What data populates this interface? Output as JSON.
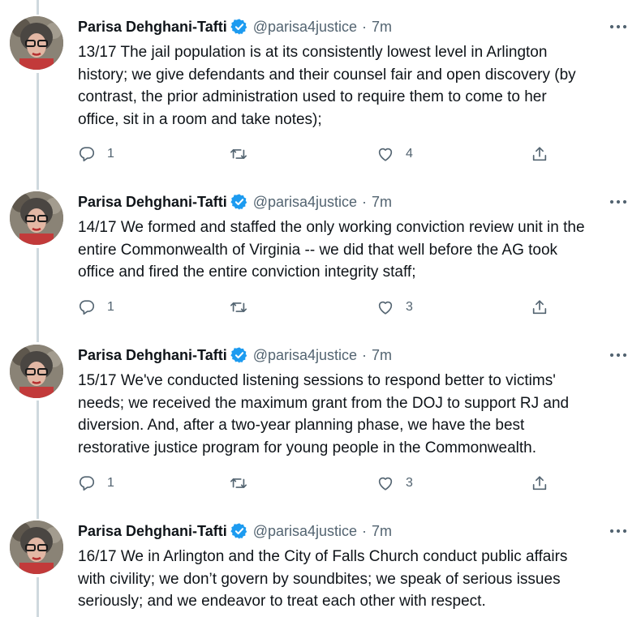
{
  "colors": {
    "text": "#0f1419",
    "secondary": "#536471",
    "verified": "#1d9bf0",
    "thread_line": "#cfd9de"
  },
  "tweets": [
    {
      "author": "Parisa Dehghani-Tafti",
      "handle": "@parisa4justice",
      "separator": "·",
      "time": "7m",
      "lines": [
        "13/17 The jail population is at its consistently lowest level in Arlington",
        "history; we give defendants and their counsel fair and open discovery (by",
        "contrast, the prior administration used to require them to come to her",
        "office, sit in a room and take notes);"
      ],
      "replies": "1",
      "retweets": "",
      "likes": "4"
    },
    {
      "author": "Parisa Dehghani-Tafti",
      "handle": "@parisa4justice",
      "separator": "·",
      "time": "7m",
      "lines": [
        "14/17 We formed and staffed the only working conviction review unit in the",
        "entire Commonwealth of Virginia -- we did that well before the AG took",
        "office and fired the entire conviction integrity staff;"
      ],
      "replies": "1",
      "retweets": "",
      "likes": "3"
    },
    {
      "author": "Parisa Dehghani-Tafti",
      "handle": "@parisa4justice",
      "separator": "·",
      "time": "7m",
      "lines": [
        "15/17 We've conducted listening sessions to respond better to victims'",
        "needs; we received the maximum grant from the DOJ to support RJ and",
        "diversion. And, after a two-year planning phase, we have  the best",
        "restorative justice program for young people in the Commonwealth."
      ],
      "replies": "1",
      "retweets": "",
      "likes": "3"
    },
    {
      "author": "Parisa Dehghani-Tafti",
      "handle": "@parisa4justice",
      "separator": "·",
      "time": "7m",
      "lines": [
        "16/17 We in Arlington and the City of Falls Church conduct public affairs",
        "with civility; we don’t govern by soundbites; we speak of serious issues",
        "seriously; and we endeavor to treat each other with respect."
      ],
      "replies": "",
      "retweets": "",
      "likes": ""
    }
  ]
}
